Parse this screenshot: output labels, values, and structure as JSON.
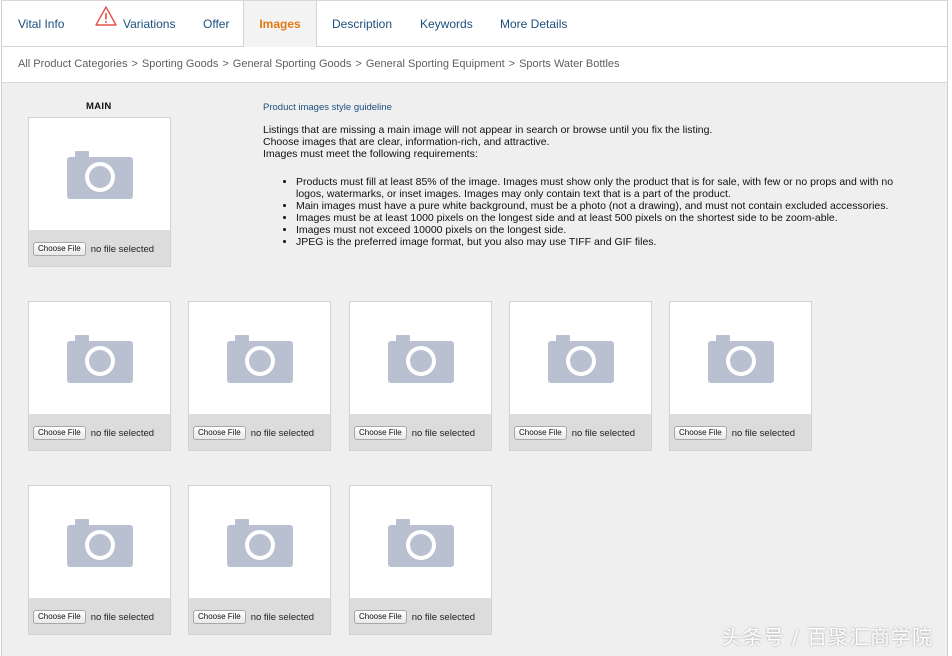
{
  "tabs": [
    {
      "label": "Vital Info"
    },
    {
      "label": "Variations",
      "icon": "warning-icon"
    },
    {
      "label": "Offer"
    },
    {
      "label": "Images",
      "active": true
    },
    {
      "label": "Description"
    },
    {
      "label": "Keywords"
    },
    {
      "label": "More Details"
    }
  ],
  "breadcrumb": [
    "All Product Categories",
    "Sporting Goods",
    "General Sporting Goods",
    "General Sporting Equipment",
    "Sports Water Bottles"
  ],
  "breadcrumb_separator": ">",
  "main_label": "MAIN",
  "guideline": {
    "link": "Product images style guideline",
    "intro": [
      "Listings that are missing a main image will not appear in search or browse until you fix the listing.",
      "Choose images that are clear, information-rich, and attractive.",
      "Images must meet the following requirements:"
    ],
    "requirements": [
      "Products must fill at least 85% of the image. Images must show only the product that is for sale, with few or no props and with no logos, watermarks, or inset images. Images may only contain text that is a part of the product.",
      "Main images must have a pure white background, must be a photo (not a drawing), and must not contain excluded accessories.",
      "Images must be at least 1000 pixels on the longest side and at least 500 pixels on the shortest side to be zoom-able.",
      "Images must not exceed 10000 pixels on the longest side.",
      "JPEG is the preferred image format, but you also may use TIFF and GIF files."
    ]
  },
  "upload": {
    "button_label": "Choose File",
    "status": "no file selected"
  },
  "watermark": "头条号 / 百聚汇商学院",
  "colors": {
    "link": "#1b4f7e",
    "active_tab": "#e47911",
    "camera": "#b9c1d0",
    "panel": "#efefef"
  }
}
